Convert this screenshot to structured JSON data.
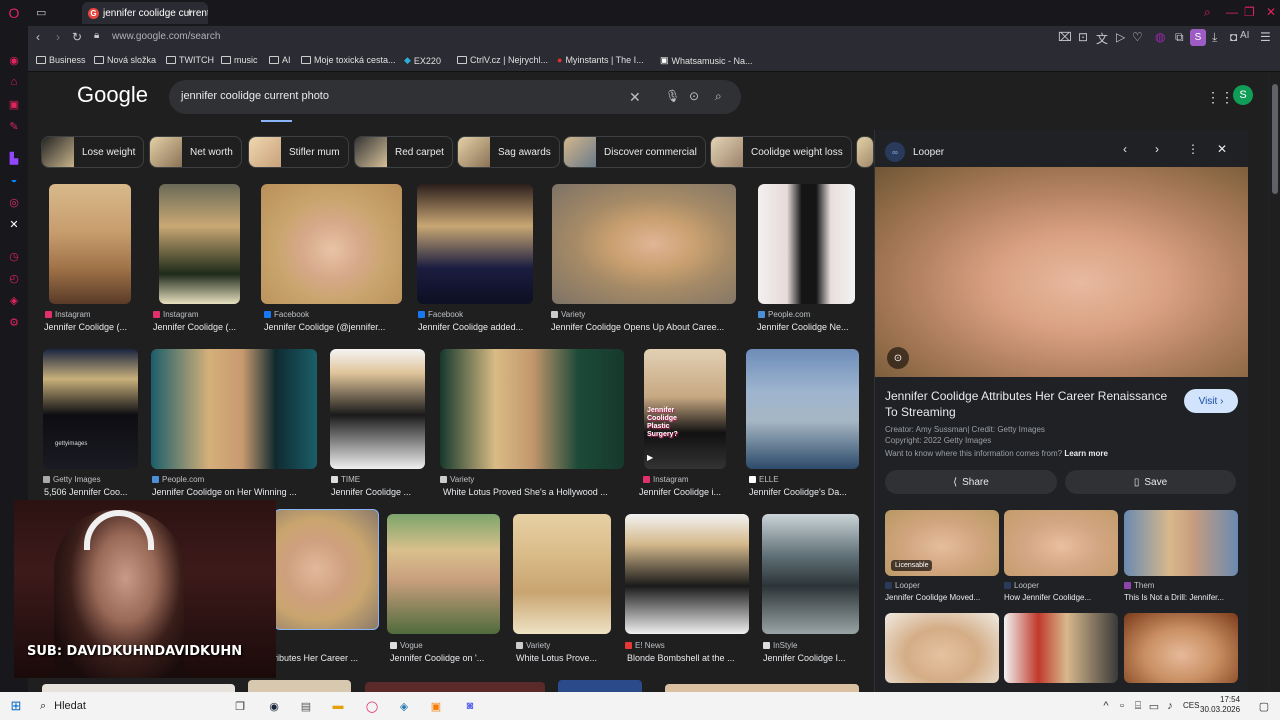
{
  "browser": {
    "tab_title": "jennifer coolidge current p",
    "url": "www.google.com/search",
    "profile_letter": "S",
    "ai_label": "AI",
    "bookmarks": [
      "Business",
      "Nová složka",
      "TWITCH",
      "music",
      "AI",
      "Moje toxická cesta...",
      "EX220",
      "CtrlV.cz | Nejrychl...",
      "Myinstants | The I...",
      "Whatsamusic - Na..."
    ]
  },
  "google": {
    "logo": "Google",
    "query": "jennifer coolidge current photo",
    "account_letter": "S",
    "chips": [
      "Lose weight",
      "Net worth",
      "Stifler mum",
      "Red carpet",
      "Sag awards",
      "Discover commercial",
      "Coolidge weight loss"
    ]
  },
  "results": [
    {
      "source": "Instagram",
      "title": "Jennifer Coolidge (..."
    },
    {
      "source": "Instagram",
      "title": "Jennifer Coolidge (..."
    },
    {
      "source": "Facebook",
      "title": "Jennifer Coolidge (@jennifer..."
    },
    {
      "source": "Facebook",
      "title": "Jennifer Coolidge added..."
    },
    {
      "source": "Variety",
      "title": "Jennifer Coolidge Opens Up About Caree..."
    },
    {
      "source": "People.com",
      "title": "Jennifer Coolidge Ne..."
    },
    {
      "source": "Getty Images",
      "title": "5,506 Jennifer Coo..."
    },
    {
      "source": "People.com",
      "title": "Jennifer Coolidge on Her Winning ..."
    },
    {
      "source": "TIME",
      "title": "Jennifer Coolidge ..."
    },
    {
      "source": "Variety",
      "title": "White Lotus Proved She's a Hollywood ..."
    },
    {
      "source": "Instagram",
      "title": "Jennifer Coolidge i..."
    },
    {
      "source": "ELLE",
      "title": "Jennifer Coolidge's Da..."
    },
    {
      "source": "",
      "title": "ributes Her Career ..."
    },
    {
      "source": "Vogue",
      "title": "Jennifer Coolidge on '..."
    },
    {
      "source": "Variety",
      "title": "White Lotus Prove..."
    },
    {
      "source": "E! News",
      "title": "Blonde Bombshell at the ..."
    },
    {
      "source": "InStyle",
      "title": "Jennifer Coolidge I..."
    }
  ],
  "overlay_texts": {
    "getty_watermark": "gettyimages",
    "plastic_surgery": "Jennifer Coolidge Plastic Surgery?"
  },
  "preview": {
    "source": "Looper",
    "title": "Jennifer Coolidge Attributes Her Career Renaissance To Streaming",
    "visit_label": "Visit",
    "creator": "Creator: Amy Sussman| Credit: Getty Images",
    "copyright": "Copyright: 2022 Getty Images",
    "info_question": "Want to know where this information comes from?",
    "learn_more": "Learn more",
    "share_label": "Share",
    "save_label": "Save",
    "related": [
      {
        "badge": "Licensable",
        "source": "Looper",
        "title": "Jennifer Coolidge Moved..."
      },
      {
        "badge": "",
        "source": "Looper",
        "title": "How Jennifer Coolidge..."
      },
      {
        "badge": "",
        "source": "Them",
        "title": "This Is Not a Drill: Jennifer..."
      }
    ]
  },
  "webcam": {
    "subtitle": "SUB: DAVIDKUHNDAVIDKUHN"
  },
  "taskbar": {
    "search_placeholder": "Hledat",
    "language": "CES",
    "time": "17:54",
    "date": "30.03.2026"
  }
}
